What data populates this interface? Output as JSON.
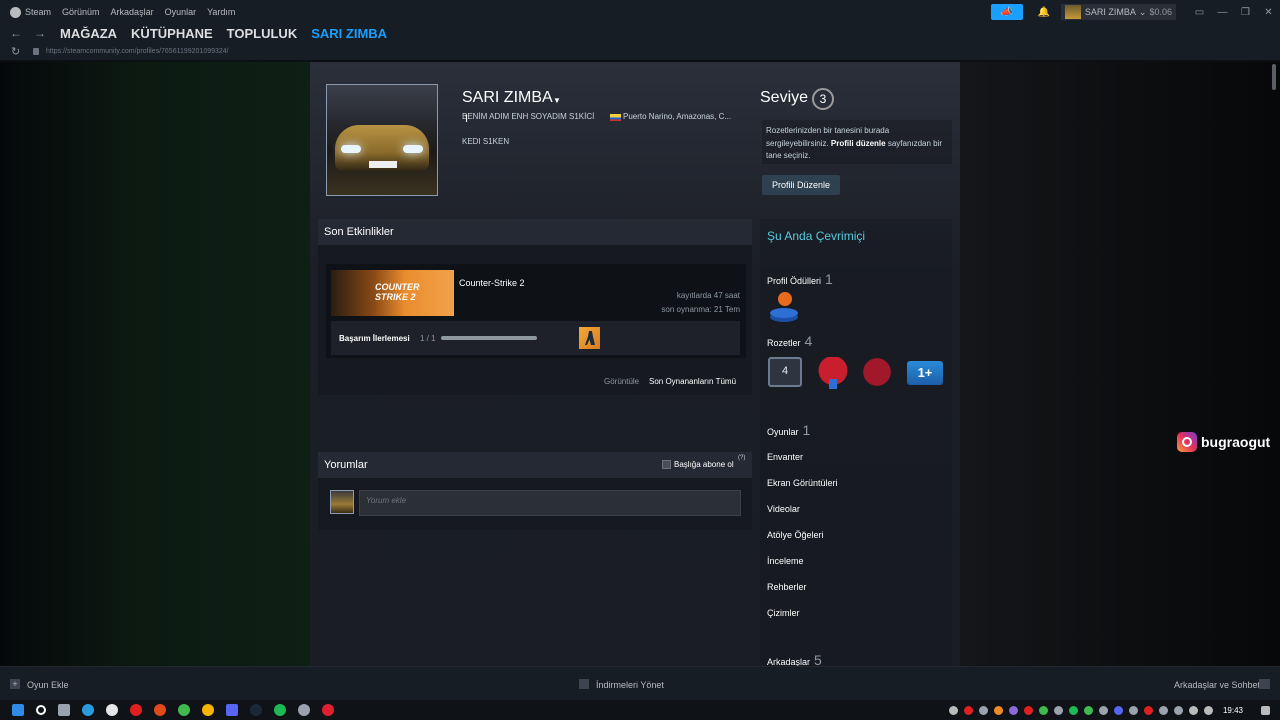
{
  "menubar": {
    "items": [
      "Steam",
      "Görünüm",
      "Arkadaşlar",
      "Oyunlar",
      "Yardım"
    ],
    "username": "SARI ZIMBA",
    "wallet": "$0.06"
  },
  "nav": {
    "items": [
      "MAĞAZA",
      "KÜTÜPHANE",
      "TOPLULUK",
      "SARI ZIMBA"
    ],
    "active": "SARI ZIMBA",
    "url": "https://steamcommunity.com/profiles/76561199201099324/"
  },
  "profile": {
    "persona_name": "SARI ZIMBA",
    "real_name": "BENİM ADIM ENH SOYADIM S1KİCİ",
    "location": "Puerto Narino, Amazonas, C...",
    "summary": "KEDI S1KEN",
    "level_label": "Seviye",
    "level": "3",
    "badge_hint_1": "Rozetlerinizden bir tanesini burada sergileyebilirsiniz. ",
    "badge_hint_bold": "Profili düzenle",
    "badge_hint_2": " sayfanızdan bir tane seçiniz.",
    "edit_button": "Profili Düzenle"
  },
  "activity": {
    "title": "Son Etkinlikler",
    "game": {
      "name": "Counter-Strike 2",
      "capsule_text": "COUNTER STRIKE 2",
      "hours": "kayıtlarda 47 saat",
      "last_played": "son oynanma: 21 Tem",
      "ach_label": "Başarım İlerlemesi",
      "ach_count": "1 / 1",
      "ach_progress": 1.0
    },
    "view_prefix": "Görüntüle",
    "view_link": "Son Oynananların Tümü"
  },
  "comments": {
    "title": "Yorumlar",
    "subscribe": "Başlığa abone ol",
    "help": "(?)",
    "placeholder": "Yorum ekle"
  },
  "sidebar": {
    "status": "Şu Anda Çevrimiçi",
    "awards_label": "Profil Ödülleri",
    "awards_count": "1",
    "badges_label": "Rozetler",
    "badges_count": "4",
    "badge_1_text": "4",
    "badge_4_text": "1+",
    "games_label": "Oyunlar",
    "games_count": "1",
    "links": [
      "Envanter",
      "Ekran Görüntüleri",
      "Videolar",
      "Atölye Öğeleri",
      "İnceleme",
      "Rehberler",
      "Çizimler"
    ],
    "friends_label": "Arkadaşlar",
    "friends_count": "5"
  },
  "bottom": {
    "add_game": "Oyun Ekle",
    "downloads": "İndirmeleri Yönet",
    "friends_chat": "Arkadaşlar ve Sohbet"
  },
  "overlay": {
    "instagram": "bugraogut"
  },
  "taskbar": {
    "time": "19:43"
  }
}
